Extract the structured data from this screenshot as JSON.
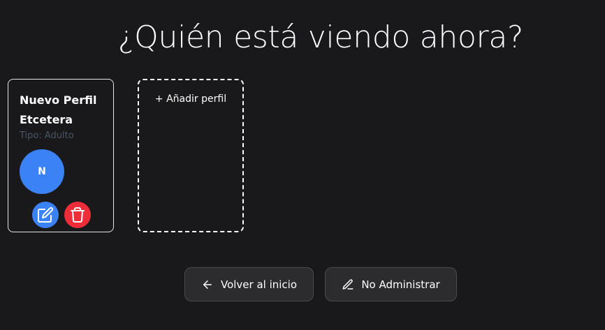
{
  "page": {
    "title": "¿Quién está viendo ahora?"
  },
  "profiles": [
    {
      "name": "Nuevo Perfil Etcetera",
      "type": "Tipo: Adulto",
      "initial": "N",
      "avatar_color": "#3b82f6",
      "edit_icon": "edit-icon",
      "delete_icon": "trash-icon"
    }
  ],
  "add_profile": {
    "label": "+ Añadir perfil"
  },
  "actions": {
    "back_label": "Volver al inicio",
    "back_icon": "arrow-left-icon",
    "admin_label": "No Administrar",
    "admin_icon": "pencil-icon"
  },
  "colors": {
    "background": "#19191b",
    "accent_blue": "#3b82f6",
    "danger_red": "#ef2d3a"
  }
}
